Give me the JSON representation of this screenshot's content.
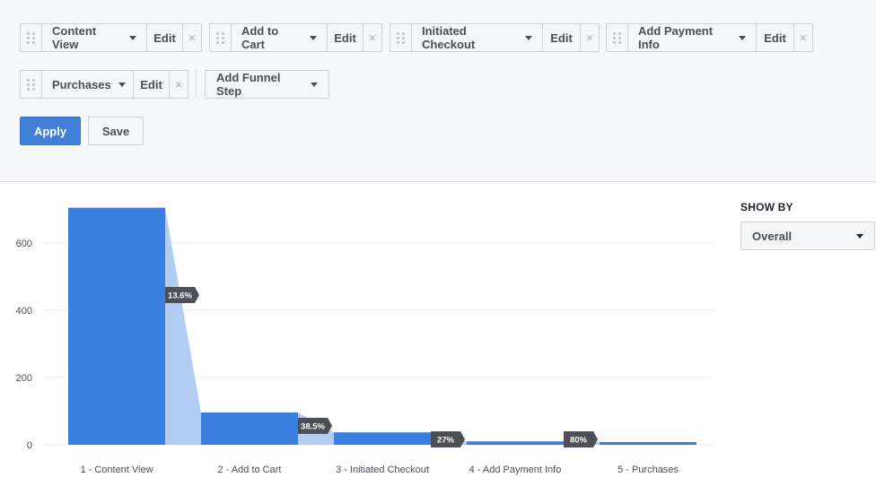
{
  "funnel_steps": {
    "row1": [
      {
        "name": "Content View",
        "edit": "Edit",
        "remove": "×"
      },
      {
        "name": "Add to Cart",
        "edit": "Edit",
        "remove": "×"
      },
      {
        "name": "Initiated Checkout",
        "edit": "Edit",
        "remove": "×"
      },
      {
        "name": "Add Payment Info",
        "edit": "Edit",
        "remove": "×"
      }
    ],
    "row2": [
      {
        "name": "Purchases",
        "edit": "Edit",
        "remove": "×"
      }
    ],
    "add_step_label": "Add Funnel Step"
  },
  "actions": {
    "apply_label": "Apply",
    "save_label": "Save"
  },
  "show_by": {
    "label": "SHOW BY",
    "selected": "Overall"
  },
  "colors": {
    "bar": "#3a7fe0",
    "drop": "#b3cdf2",
    "badge": "#4b4f56",
    "apply": "#4080d9"
  },
  "chart_data": {
    "type": "bar",
    "categories": [
      "1 - Content View",
      "2 - Add to Cart",
      "3 - Initiated Checkout",
      "4 - Add Payment Info",
      "5 - Purchases"
    ],
    "values": [
      705,
      96,
      37,
      10,
      8
    ],
    "conversion_labels": [
      "13.6%",
      "38.5%",
      "27%",
      "80%"
    ],
    "ylim": [
      0,
      720
    ],
    "yticks": [
      0,
      200,
      400,
      600
    ],
    "grid": true,
    "legend": "none",
    "title": "",
    "xlabel": "",
    "ylabel": ""
  }
}
